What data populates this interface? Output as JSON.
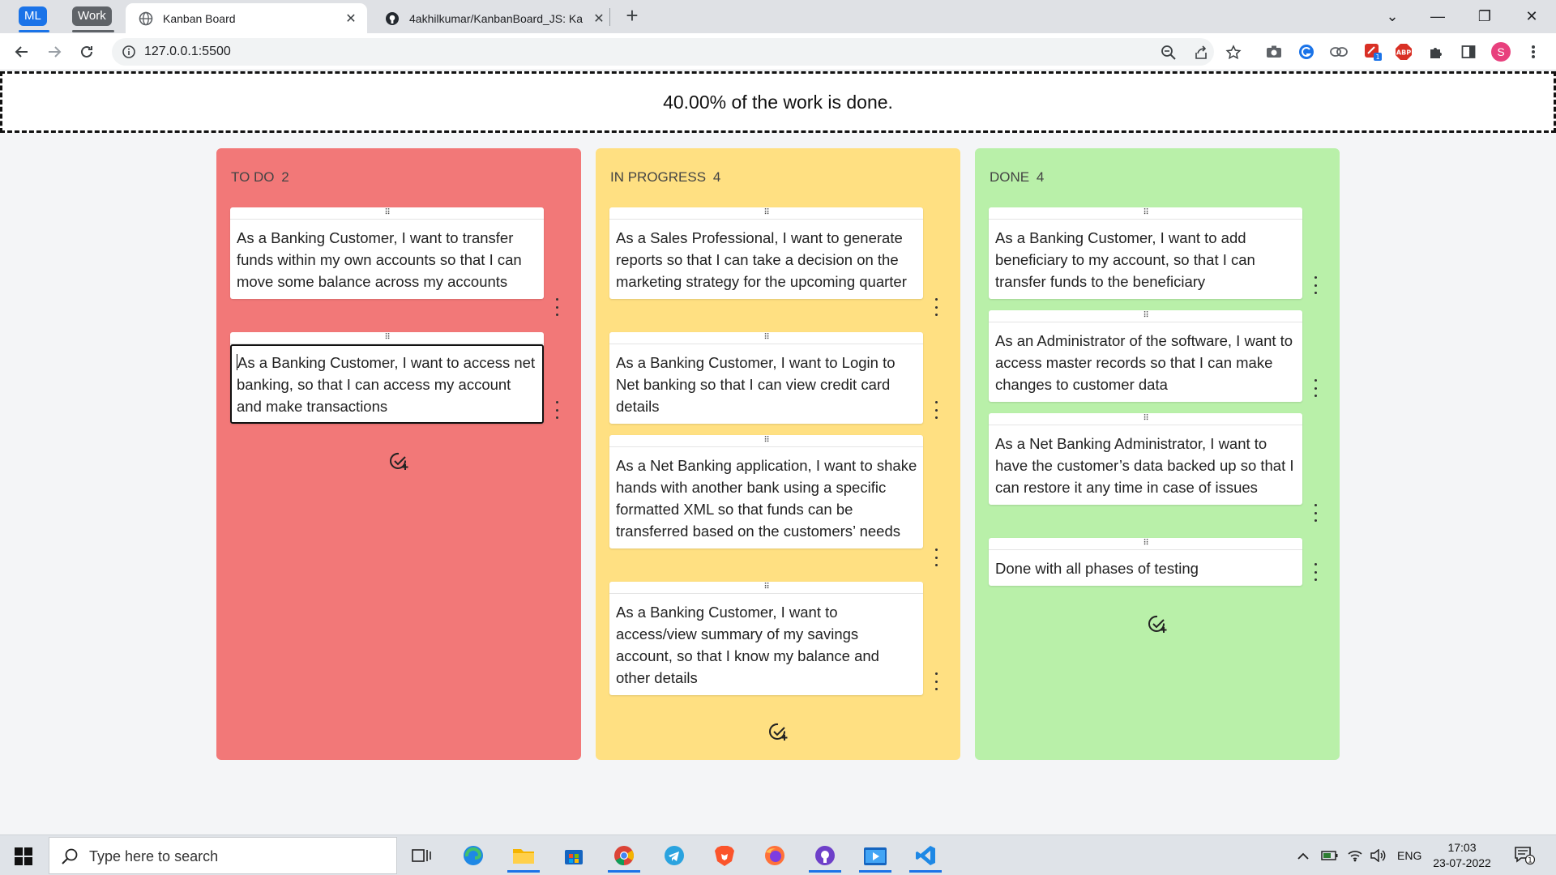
{
  "browser": {
    "tab_groups": [
      {
        "label": "ML",
        "color": "#1a73e8"
      },
      {
        "label": "Work",
        "color": "#5f6368"
      }
    ],
    "tabs": [
      {
        "title": "Kanban Board",
        "active": true
      },
      {
        "title": "4akhilkumar/KanbanBoard_JS: Ka",
        "active": false
      }
    ],
    "url": "127.0.0.1:5500",
    "profile_initial": "S",
    "extension_badge": "1",
    "adblock_label": "ABP"
  },
  "page": {
    "progress_text": "40.00% of the work is done."
  },
  "columns": [
    {
      "title": "TO DO",
      "count": "2",
      "color": "#f27878",
      "cards": [
        {
          "text": "As a Banking Customer, I want to transfer funds within my own accounts so that I can move some balance across my accounts"
        },
        {
          "text": "As a Banking Customer, I want to access net banking, so that I can access my account and make transactions",
          "editing": true
        }
      ]
    },
    {
      "title": "IN PROGRESS",
      "count": "4",
      "color": "#ffe082",
      "cards": [
        {
          "text": "As a Sales Professional, I want to generate reports so that I can take a decision on the marketing strategy for the upcoming quarter"
        },
        {
          "text": "As a Banking Customer, I want to Login to Net banking so that I can view credit card details"
        },
        {
          "text": "As a Net Banking application, I want to shake hands with another bank using a specific formatted XML so that funds can be transferred based on the customers’ needs"
        },
        {
          "text": "As a Banking Customer, I want to access/view summary of my savings account, so that I know my balance and other details"
        }
      ]
    },
    {
      "title": "DONE",
      "count": "4",
      "color": "#b9f0a9",
      "cards": [
        {
          "text": "As a Banking Customer, I want to add beneficiary to my account, so that I can transfer funds to the beneficiary"
        },
        {
          "text": "As an Administrator of the software, I want to access master records so that I can make changes to customer data"
        },
        {
          "text": "As a Net Banking Administrator, I want to have the customer’s data backed up so that I can restore it any time in case of issues"
        },
        {
          "text": "Done with all phases of testing"
        }
      ]
    }
  ],
  "taskbar": {
    "search_placeholder": "Type here to search",
    "language": "ENG",
    "time": "17:03",
    "date": "23-07-2022",
    "notification_count": "1",
    "apps": [
      "task-view",
      "edge",
      "file-explorer",
      "store",
      "chrome",
      "telegram",
      "brave",
      "firefox",
      "github-desktop",
      "media-player",
      "vscode"
    ]
  }
}
